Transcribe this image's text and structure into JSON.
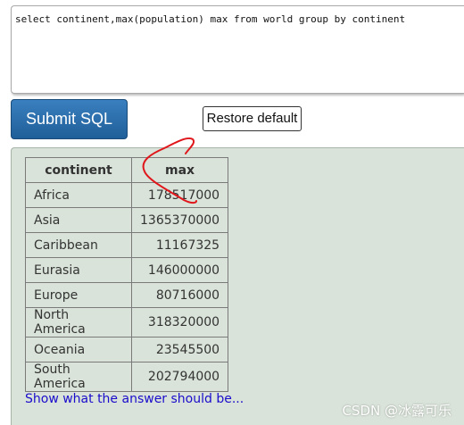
{
  "editor": {
    "sql": "select continent,max(population) max from world group by continent"
  },
  "buttons": {
    "submit_label": "Submit SQL",
    "restore_label": "Restore default"
  },
  "result": {
    "columns": [
      "continent",
      "max"
    ],
    "rows": [
      [
        "Africa",
        "178517000"
      ],
      [
        "Asia",
        "1365370000"
      ],
      [
        "Caribbean",
        "11167325"
      ],
      [
        "Eurasia",
        "146000000"
      ],
      [
        "Europe",
        "80716000"
      ],
      [
        "North America",
        "318320000"
      ],
      [
        "Oceania",
        "23545500"
      ],
      [
        "South America",
        "202794000"
      ]
    ]
  },
  "answer_link": "Show what the answer should be...",
  "watermark": "CSDN @冰露可乐",
  "colors": {
    "submit_bg": "#2a6fb0",
    "panel_bg": "#d9e3d9",
    "link": "#1a0dcc",
    "annotation": "#e0161b"
  }
}
